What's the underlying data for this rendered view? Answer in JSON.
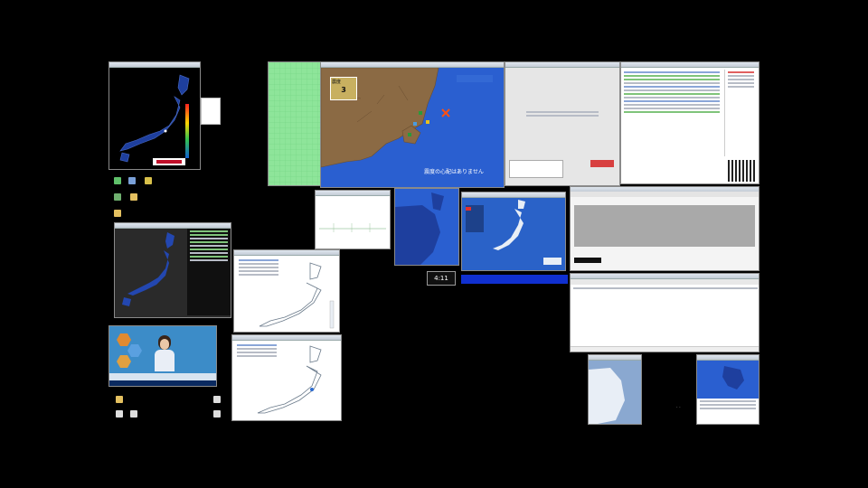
{
  "clock": {
    "time": "4:11"
  },
  "quake_map": {
    "message_jp": "震度の心配はありません",
    "info_label": "震度",
    "info_value": "3"
  },
  "colors": {
    "desktop": "#000000",
    "ocean": "#2a5fd0",
    "land": "#8b6a44",
    "map_dark": "#1a3a8a",
    "grid_green": "#8ee59a"
  },
  "icons": [
    "recycle-bin-icon",
    "folder-icon",
    "app-icon",
    "document-icon"
  ]
}
